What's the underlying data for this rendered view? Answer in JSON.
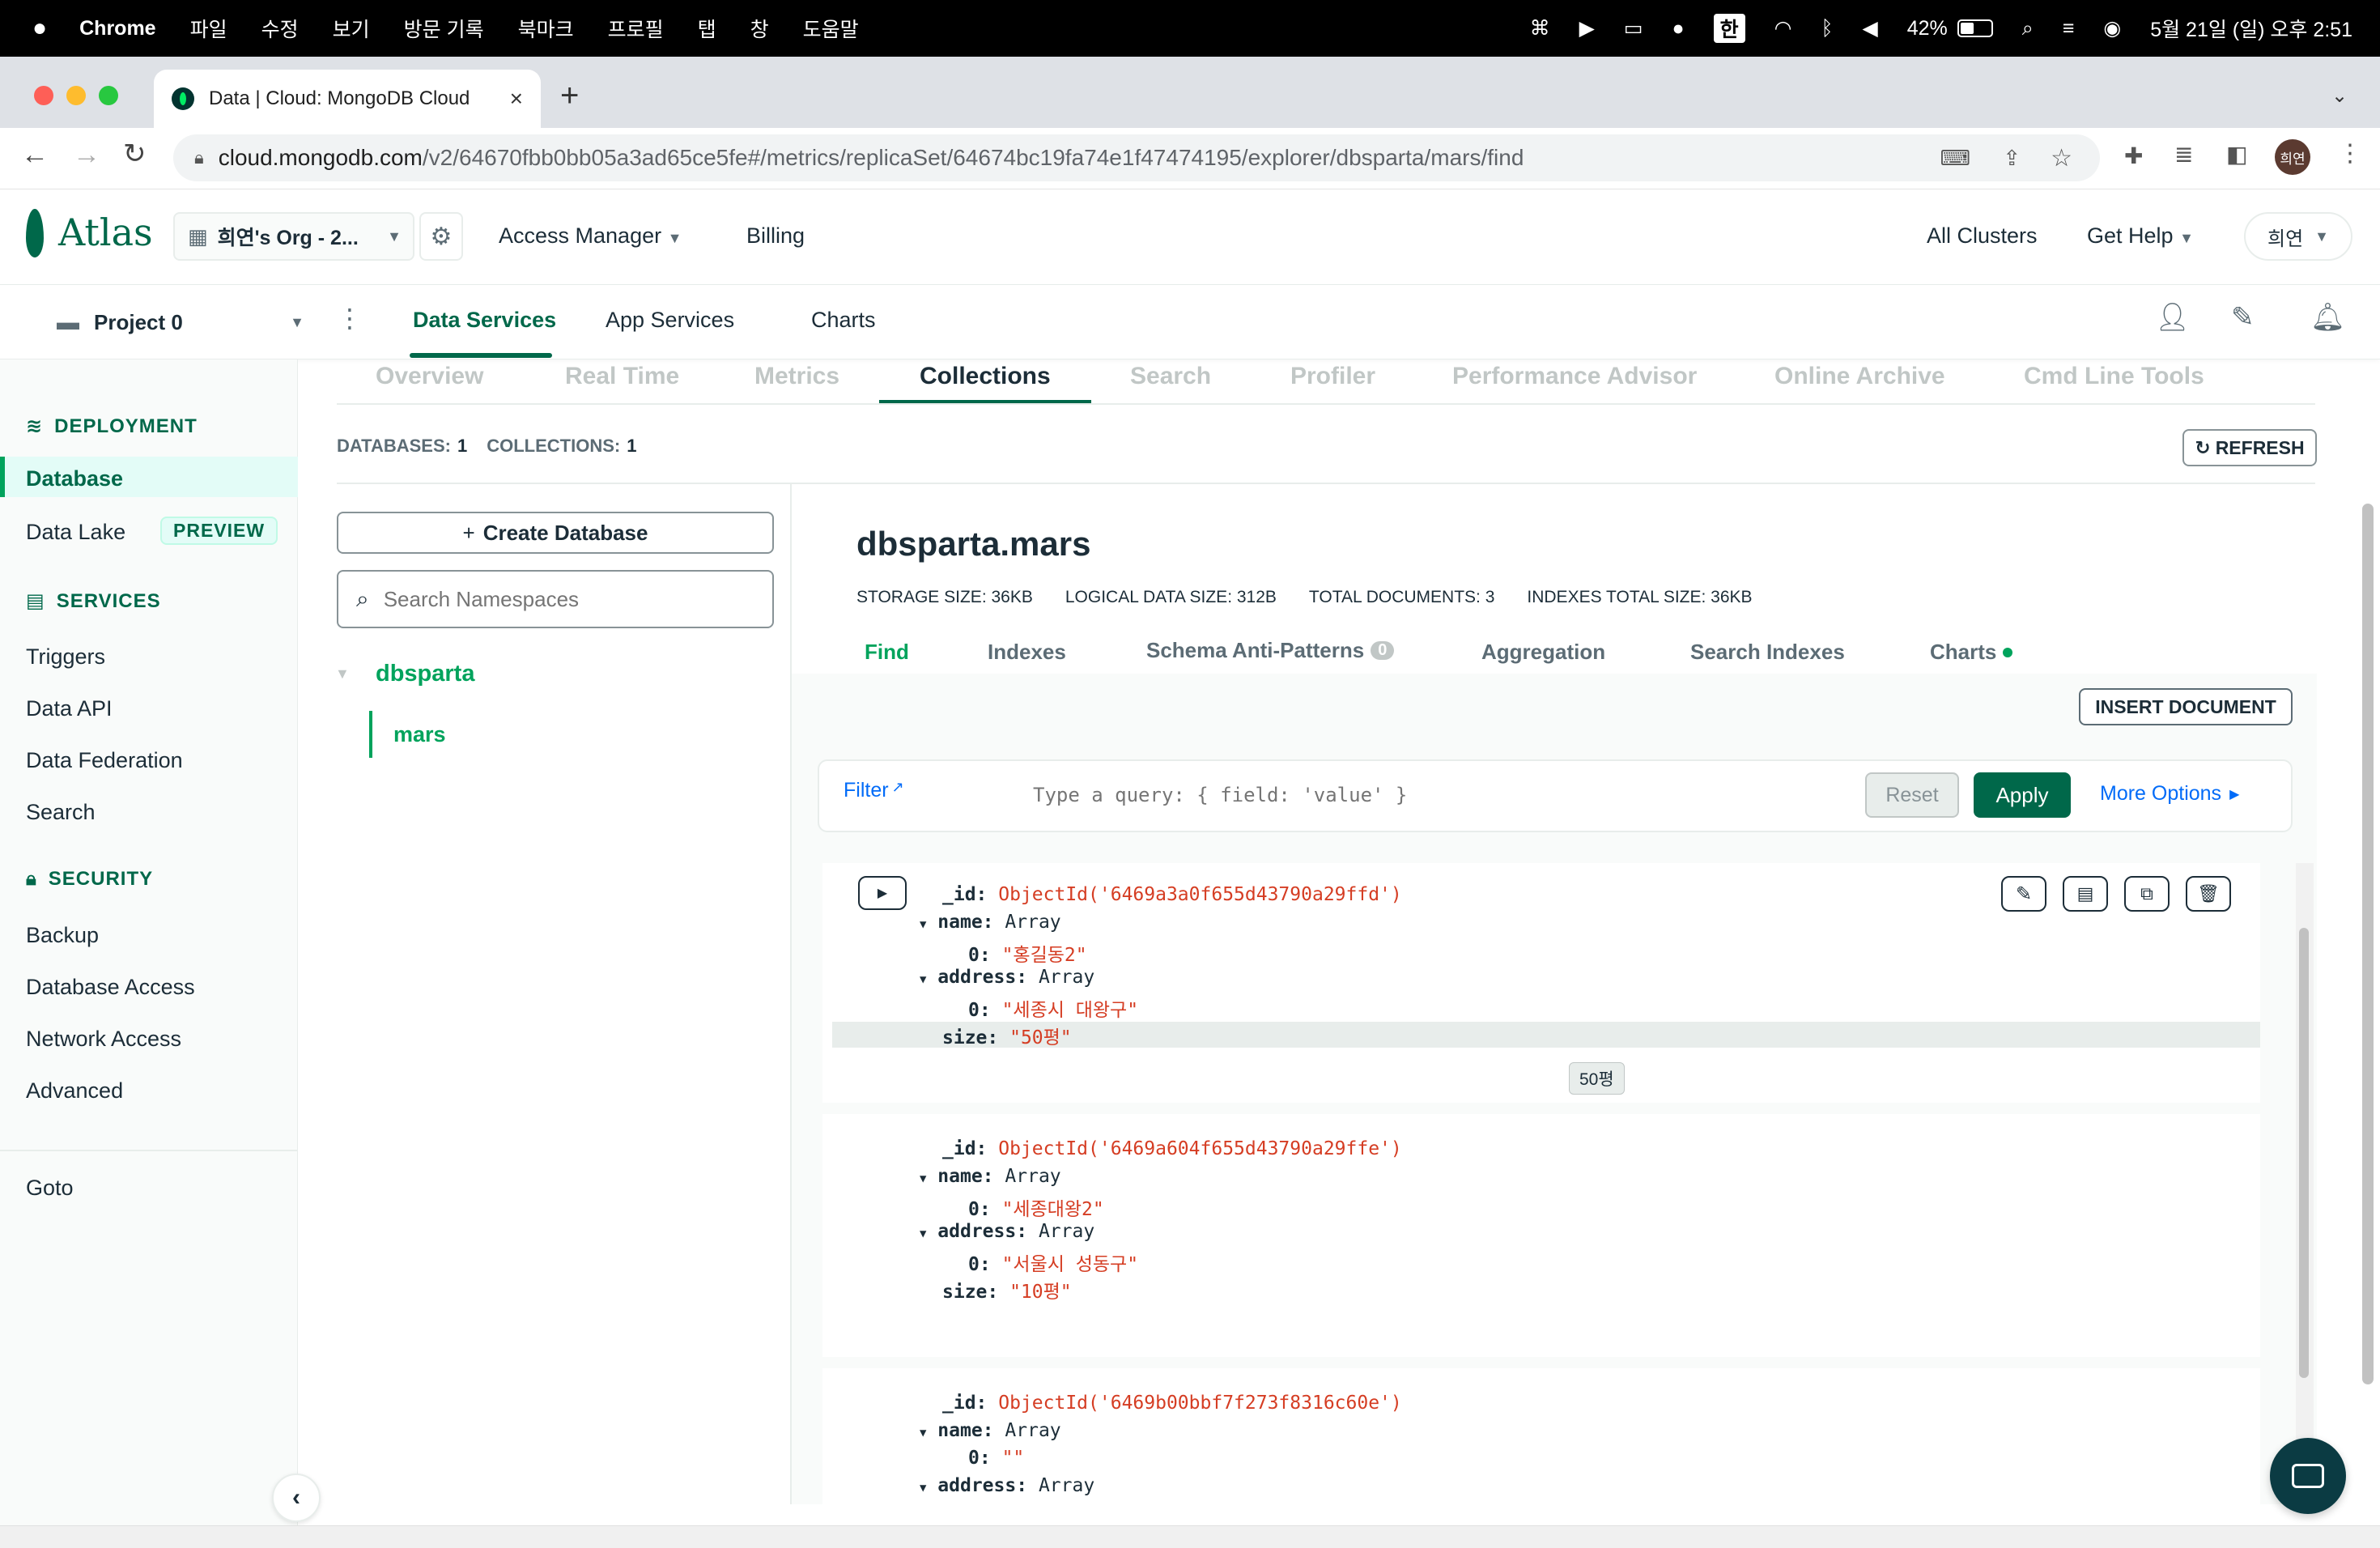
{
  "menubar": {
    "app": "Chrome",
    "menus": [
      "파일",
      "수정",
      "보기",
      "방문 기록",
      "북마크",
      "프로필",
      "탭",
      "창",
      "도움말"
    ],
    "battery": "42%",
    "ime": "한",
    "datetime": "5월 21일 (일) 오후 2:51"
  },
  "browser": {
    "tab_title": "Data | Cloud: MongoDB Cloud",
    "url_host": "cloud.mongodb.com",
    "url_path": "/v2/64670fbb0bb05a3ad65ce5fe#/metrics/replicaSet/64674bc19fa74e1f47474195/explorer/dbsparta/mars/find",
    "profile_initials": "희연"
  },
  "topnav": {
    "logo": "Atlas",
    "org": "희연's Org - 2...",
    "access_manager": "Access Manager",
    "billing": "Billing",
    "all_clusters": "All Clusters",
    "get_help": "Get Help",
    "user": "희연"
  },
  "projnav": {
    "project": "Project 0",
    "tabs": [
      "Data Services",
      "App Services",
      "Charts"
    ]
  },
  "sidebar": {
    "deployment": "DEPLOYMENT",
    "database": "Database",
    "data_lake": "Data Lake",
    "preview": "PREVIEW",
    "services": "SERVICES",
    "triggers": "Triggers",
    "data_api": "Data API",
    "data_federation": "Data Federation",
    "search": "Search",
    "security": "SECURITY",
    "backup": "Backup",
    "database_access": "Database Access",
    "network_access": "Network Access",
    "advanced": "Advanced",
    "goto": "Goto"
  },
  "cluster_tabs": [
    "Overview",
    "Real Time",
    "Metrics",
    "Collections",
    "Search",
    "Profiler",
    "Performance Advisor",
    "Online Archive",
    "Cmd Line Tools"
  ],
  "stats": {
    "databases_label": "DATABASES:",
    "databases": "1",
    "collections_label": "COLLECTIONS:",
    "collections": "1",
    "refresh": "REFRESH"
  },
  "namespaces": {
    "create_db": "Create Database",
    "search_placeholder": "Search Namespaces",
    "db": "dbsparta",
    "collection": "mars"
  },
  "collection": {
    "title": "dbsparta.mars",
    "storage_size": "STORAGE SIZE: 36KB",
    "logical_size": "LOGICAL DATA SIZE: 312B",
    "total_docs": "TOTAL DOCUMENTS: 3",
    "indexes_size": "INDEXES TOTAL SIZE: 36KB",
    "tabs": [
      "Find",
      "Indexes",
      "Schema Anti-Patterns",
      "Aggregation",
      "Search Indexes",
      "Charts"
    ],
    "anti_pattern_count": "0",
    "insert_document": "INSERT DOCUMENT",
    "filter_label": "Filter",
    "filter_placeholder": "Type a query: { field: 'value' }",
    "reset": "Reset",
    "apply": "Apply",
    "more_options": "More Options",
    "tooltip": "50평"
  },
  "documents": [
    {
      "id": "ObjectId('6469a3a0f655d43790a29ffd')",
      "name": "\"홍길동2\"",
      "address": "\"세종시 대왕구\"",
      "size": "\"50평\""
    },
    {
      "id": "ObjectId('6469a604f655d43790a29ffe')",
      "name": "\"세종대왕2\"",
      "address": "\"서울시 성동구\"",
      "size": "\"10평\""
    },
    {
      "id": "ObjectId('6469b00bbf7f273f8316c60e')",
      "name": "\"\"",
      "address": "",
      "size": ""
    }
  ],
  "doc_labels": {
    "id": "_id:",
    "name": "name:",
    "address": "address:",
    "size": "size:",
    "array": "Array",
    "idx0": "0:"
  }
}
